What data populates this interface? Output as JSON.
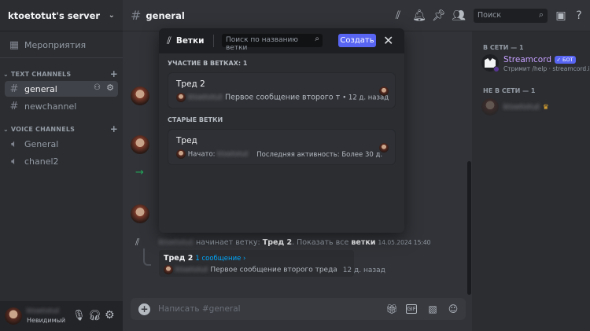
{
  "server": {
    "name": "ktoetotut's server"
  },
  "sidebar": {
    "events_label": "Мероприятия",
    "text_category": "TEXT CHANNELS",
    "voice_category": "VOICE CHANNELS",
    "text_channels": [
      {
        "label": "general"
      },
      {
        "label": "newchannel"
      }
    ],
    "voice_channels": [
      {
        "label": "General"
      },
      {
        "label": "chanel2"
      }
    ]
  },
  "user": {
    "name": "ktoetotut",
    "status": "Невидимый"
  },
  "topbar": {
    "channel": "general",
    "search_placeholder": "Поиск"
  },
  "threads_popup": {
    "title": "Ветки",
    "search_placeholder": "Поиск по названию ветки",
    "create_label": "Создать",
    "joined_header": "УЧАСТИЕ В ВЕТКАХ: 1",
    "old_header": "СТАРЫЕ ВЕТКИ",
    "joined": {
      "name": "Тред 2",
      "author": "ktoetotut",
      "message": "Первое сообщение второго т",
      "time": "• 12 д. назад"
    },
    "old": {
      "name": "Тред",
      "started_label": "Начато:",
      "author": "ktoetotut",
      "activity": "Последняя активность: Более 30 д."
    }
  },
  "chat": {
    "thread_msg": {
      "author": "ktoetotut",
      "text1": "начинает ветку:",
      "thread_name": "Тред 2",
      "text2": ". Показать все",
      "link": "ветки",
      "timestamp": "14.05.2024 15:40"
    },
    "thread_embed": {
      "name": "Тред 2",
      "count": "1 сообщение ›",
      "author": "ktoetotut",
      "message": "Первое сообщение второго треда",
      "time": "12 д. назад"
    },
    "input_placeholder": "Написать #general"
  },
  "members": {
    "online_header": "В СЕТИ — 1",
    "offline_header": "НЕ В СЕТИ — 1",
    "online": [
      {
        "name": "Streamcord",
        "badge": "✓ БОТ",
        "status": "Стримит /help · streamcord.io"
      }
    ],
    "offline": [
      {
        "name": "ktoetotut"
      }
    ]
  },
  "colors": {
    "accent": "#5865f2",
    "link": "#00a8fc",
    "green": "#23a559"
  }
}
